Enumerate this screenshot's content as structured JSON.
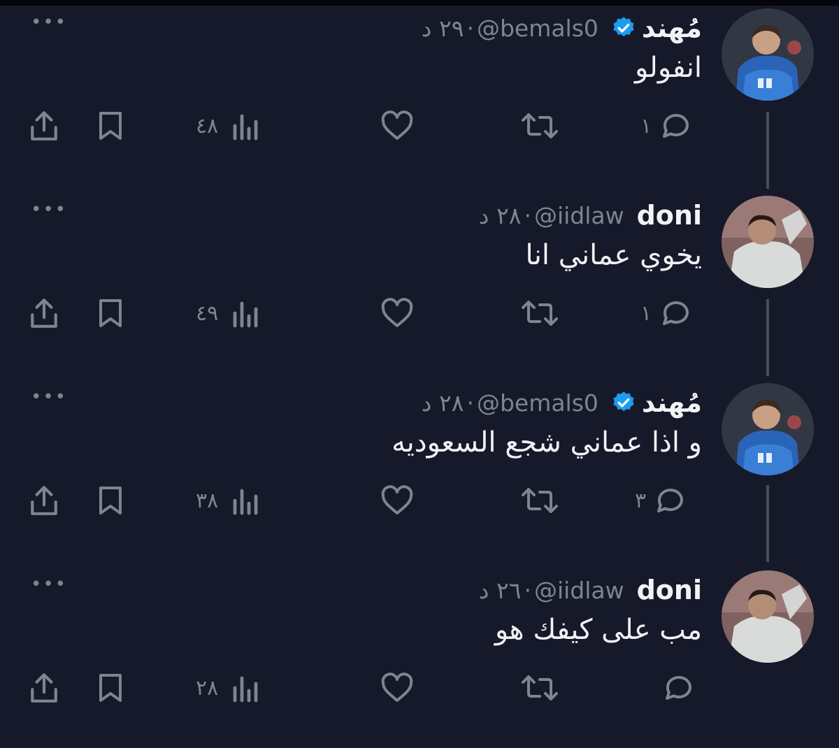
{
  "tweets": [
    {
      "name": "مُهند",
      "verified": true,
      "handle": "@bemals0",
      "time": "٢٩ د",
      "text": "انفولو",
      "replies": "١",
      "views": "٤٨",
      "avatar": "blue-player"
    },
    {
      "name": "doni",
      "verified": false,
      "handle": "@iidlaw",
      "time": "٢٨ د",
      "text": "يخوي عماني انا",
      "replies": "١",
      "views": "٤٩",
      "avatar": "white-player"
    },
    {
      "name": "مُهند",
      "verified": true,
      "handle": "@bemals0",
      "time": "٢٨ د",
      "text": "و اذا عماني شجع السعوديه",
      "replies": "٣",
      "views": "٣٨",
      "avatar": "blue-player"
    },
    {
      "name": "doni",
      "verified": false,
      "handle": "@iidlaw",
      "time": "٢٦ د",
      "text": "مب على كيفك هو",
      "replies": "",
      "views": "٢٨",
      "avatar": "white-player"
    }
  ],
  "colors": {
    "background": "#15192a",
    "muted": "#7d8590",
    "verified": "#1d9bf0",
    "text": "#f0f1f3"
  },
  "icons": [
    "more-icon",
    "verified-icon",
    "reply-icon",
    "retweet-icon",
    "like-icon",
    "views-icon",
    "bookmark-icon",
    "share-icon"
  ]
}
